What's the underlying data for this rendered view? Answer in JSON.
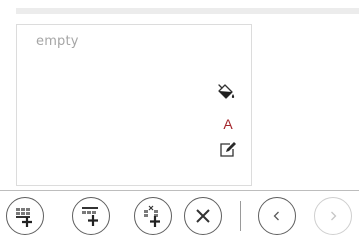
{
  "panel": {
    "placeholder": "empty"
  },
  "panel_tools": {
    "fill_icon": "paint-bucket-icon",
    "font_label": "A",
    "font_color": "#a4262c",
    "edit_icon": "edit-icon"
  },
  "toolbar": {
    "buttons": [
      {
        "icon": "insert-row-below-icon",
        "enabled": true
      },
      {
        "icon": "insert-row-above-icon",
        "enabled": true
      },
      {
        "icon": "insert-column-icon",
        "enabled": true
      },
      {
        "icon": "close-icon",
        "enabled": true
      },
      {
        "icon": "chevron-left-icon",
        "enabled": true
      },
      {
        "icon": "chevron-right-icon",
        "enabled": false
      }
    ]
  }
}
